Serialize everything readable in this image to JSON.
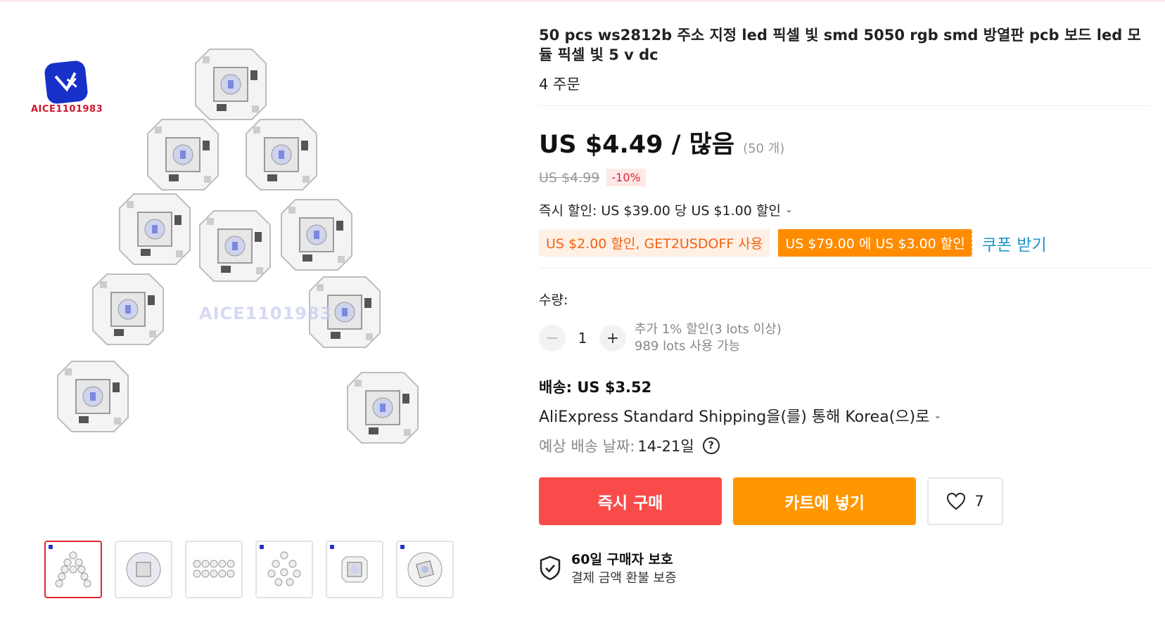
{
  "brand": {
    "name": "AICE1101983"
  },
  "watermark": "AICE1101983",
  "product": {
    "title": "50 pcs ws2812b 주소 지정 led 픽셀 빛 smd 5050 rgb smd 방열판 pcb 보드 led 모듈 픽셀 빛 5 v dc",
    "orders": "4 주문"
  },
  "price": {
    "current": "US $4.49 / 많음",
    "unit_note": "(50 개)",
    "original": "US $4.99",
    "discount": "-10%"
  },
  "promo": {
    "instant_discount": "즉시 할인: US $39.00 당 US $1.00 할인",
    "coupon_code": "US $2.00 할인, GET2USDOFF 사용",
    "coupon_store": "US $79.00 에 US $3.00 할인",
    "get_coupon": "쿠폰 받기"
  },
  "quantity": {
    "label": "수량:",
    "value": "1",
    "note_line1": "추가 1% 할인(3 lots 이상)",
    "note_line2": "989 lots 사용 가능"
  },
  "shipping": {
    "title": "배송: US $3.52",
    "method": "AliExpress Standard Shipping을(를) 통해 Korea(으)로",
    "eta_label": "예상 배송 날짜:",
    "eta_value": "14-21일"
  },
  "actions": {
    "buy_now": "즉시 구매",
    "add_to_cart": "카트에 넣기",
    "wishlist_count": "7"
  },
  "protection": {
    "title": "60일 구매자 보호",
    "subtitle": "결제 금액 환불 보증"
  },
  "icons": [
    "minus-icon",
    "plus-icon",
    "chevron-down-icon",
    "help-icon",
    "heart-icon",
    "shield-check-icon"
  ],
  "colors": {
    "buy": "#fa4b4b",
    "cart": "#ff9700",
    "coupon_link": "#1f93c7",
    "discount": "#e0262f"
  }
}
